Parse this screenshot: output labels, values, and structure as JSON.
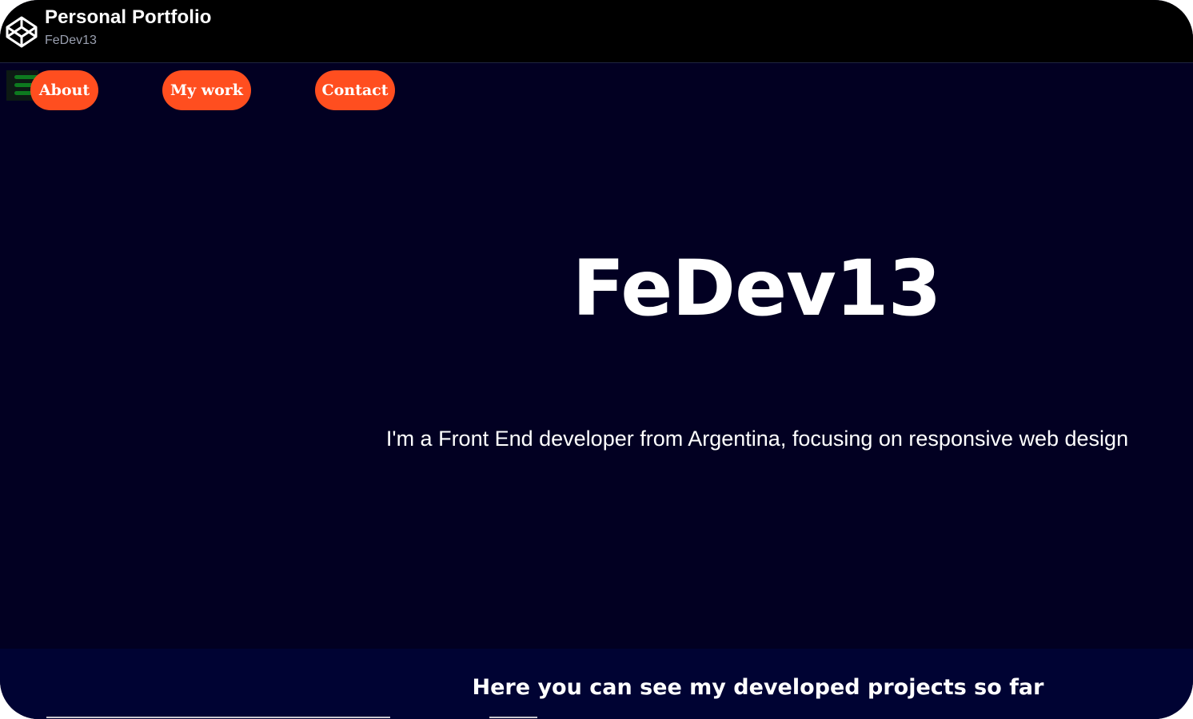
{
  "header": {
    "title": "Personal Portfolio",
    "subtitle": "FeDev13",
    "logo_icon": "codepen-logo-icon"
  },
  "nav": {
    "menu_icon": "hamburger-menu-icon",
    "items": [
      {
        "label": "About"
      },
      {
        "label": "My work"
      },
      {
        "label": "Contact"
      }
    ]
  },
  "hero": {
    "name": "FeDev13",
    "description": "I'm a Front End developer from Argentina, focusing on responsive web design"
  },
  "projects": {
    "heading": "Here you can see my developed projects so far"
  },
  "colors": {
    "background": "#020022",
    "topbar": "#000000",
    "accent": "#ff4e1f",
    "menu_icon": "#0d7a1f",
    "projects_bg": "#000333"
  }
}
